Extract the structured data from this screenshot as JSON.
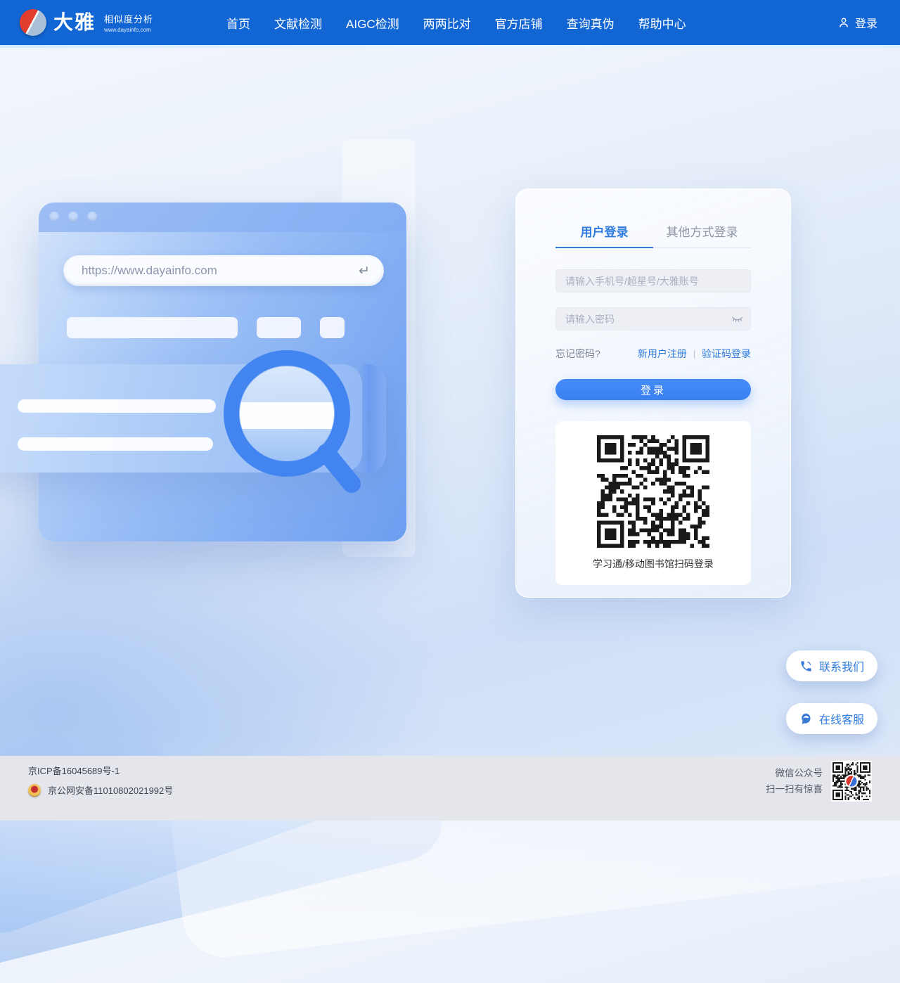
{
  "header": {
    "brand": {
      "name": "大雅",
      "subtitle": "相似度分析",
      "url": "www.dayainfo.com"
    },
    "nav": [
      {
        "label": "首页"
      },
      {
        "label": "文献检测"
      },
      {
        "label": "AIGC检测"
      },
      {
        "label": "两两比对"
      },
      {
        "label": "官方店铺"
      },
      {
        "label": "查询真伪"
      },
      {
        "label": "帮助中心"
      }
    ],
    "login_label": "登录"
  },
  "illustration": {
    "browser_url": "https://www.dayainfo.com",
    "enter_icon": "↵"
  },
  "login_card": {
    "tabs": [
      {
        "label": "用户登录",
        "active": true
      },
      {
        "label": "其他方式登录",
        "active": false
      }
    ],
    "account_placeholder": "请输入手机号/超星号/大雅账号",
    "password_placeholder": "请输入密码",
    "forgot_label": "忘记密码?",
    "register_label": "新用户注册",
    "link_divider": "|",
    "sms_login_label": "验证码登录",
    "submit_label": "登录",
    "qr_caption": "学习通/移动图书馆扫码登录"
  },
  "floating": {
    "contact_label": "联系我们",
    "service_label": "在线客服"
  },
  "footer": {
    "icp": "京ICP备16045689号-1",
    "police": "京公网安备11010802021992号",
    "wechat_line1": "微信公众号",
    "wechat_line2": "扫一扫有惊喜"
  },
  "colors": {
    "header-bg": "#1266d4",
    "link-blue": "#2f7bdd",
    "button-blue": "#3a80f2",
    "footer-bg": "#e5e6ec"
  }
}
